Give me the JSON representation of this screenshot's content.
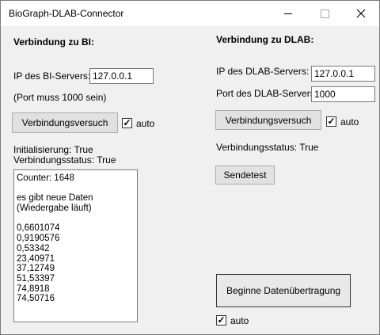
{
  "window": {
    "title": "BioGraph-DLAB-Connector"
  },
  "bi": {
    "heading": "Verbindung zu BI:",
    "ip_label": "IP des BI-Servers:",
    "ip_value": "127.0.0.1",
    "port_note": "(Port muss 1000 sein)",
    "connect_label": "Verbindungsversuch",
    "auto_label": "auto",
    "auto_mark": "✓",
    "init_status": "Initialisierung: True",
    "conn_status": "Verbindungsstatus: True",
    "log": [
      "Counter: 1648",
      "",
      "es gibt neue Daten",
      "(Wiedergabe läuft)",
      "",
      "0,6601074",
      "0,9190576",
      "0,53342",
      "23,40971",
      "37,12749",
      "51,53397",
      "74,8918",
      "74,50716"
    ]
  },
  "dlab": {
    "heading": "Verbindung zu DLAB:",
    "ip_label": "IP des DLAB-Servers:",
    "ip_value": "127.0.0.1",
    "port_label": "Port des DLAB-Servers:",
    "port_value": "1000",
    "connect_label": "Verbindungsversuch",
    "auto_label": "auto",
    "auto_mark": "✓",
    "conn_status": "Verbindungsstatus: True",
    "sendtest_label": "Sendetest",
    "start_label": "Beginne Datenübertragung",
    "start_auto_label": "auto",
    "start_auto_mark": "✓"
  }
}
